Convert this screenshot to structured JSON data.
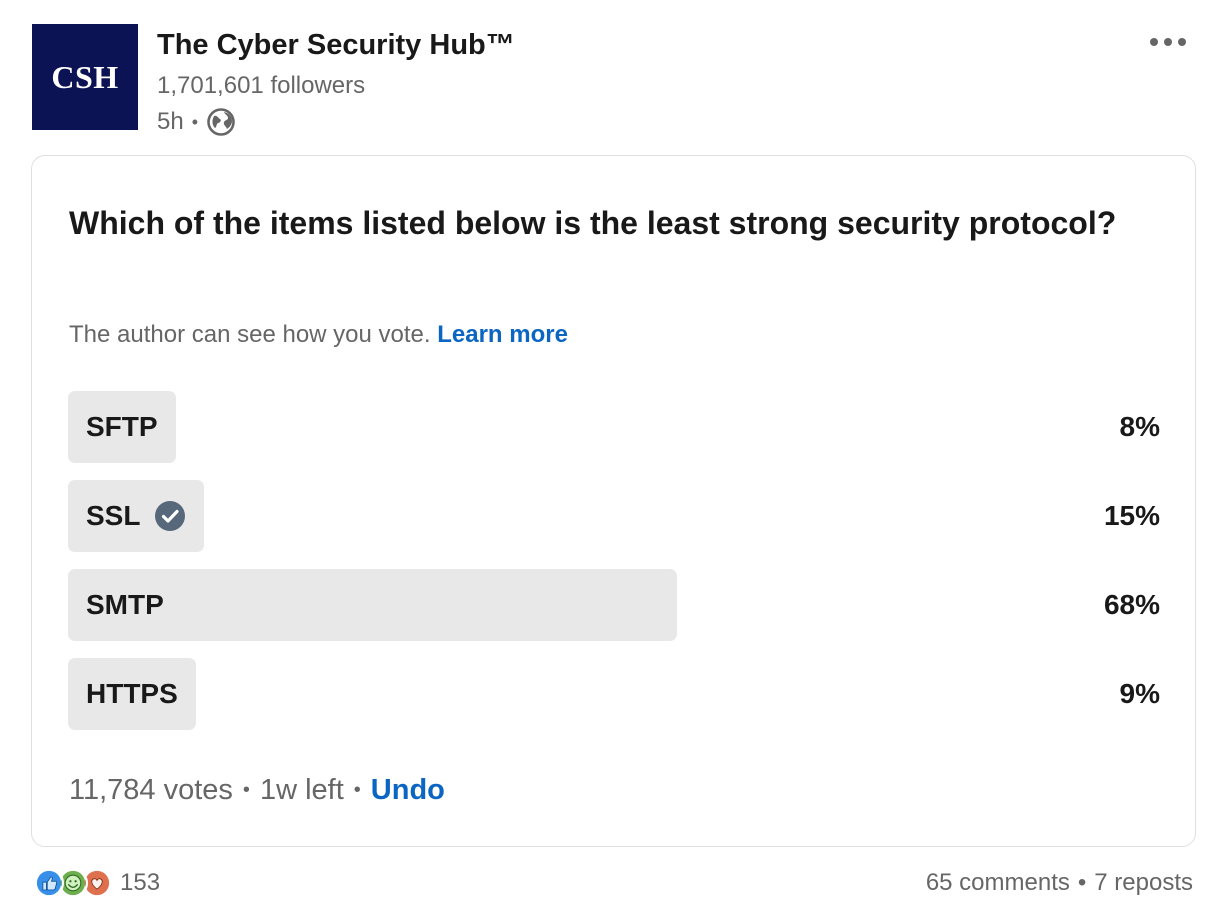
{
  "author": {
    "logo_text": "CSH",
    "name": "The Cyber Security Hub™",
    "followers": "1,701,601 followers",
    "time": "5h",
    "separator": "•"
  },
  "poll": {
    "question": "Which of the items listed below is the least strong security protocol?",
    "visibility_text": "The author can see how you vote.",
    "learn_more": "Learn more",
    "options": [
      {
        "label": "SFTP",
        "percent": "8%",
        "fraction": 0.08,
        "selected": false
      },
      {
        "label": "SSL",
        "percent": "15%",
        "fraction": 0.15,
        "selected": true
      },
      {
        "label": "SMTP",
        "percent": "68%",
        "fraction": 0.68,
        "selected": false
      },
      {
        "label": "HTTPS",
        "percent": "9%",
        "fraction": 0.09,
        "selected": false
      }
    ],
    "votes": "11,784 votes",
    "time_left": "1w left",
    "undo": "Undo",
    "separator": "•"
  },
  "social": {
    "reaction_count": "153",
    "reactions": [
      "like-icon",
      "celebrate-icon",
      "love-icon"
    ],
    "comments": "65 comments",
    "reposts": "7 reposts",
    "separator": "•"
  },
  "colors": {
    "logo_bg": "#0c1354",
    "link": "#0a66c2",
    "bar": "#e8e8e8",
    "check": "#56687a"
  }
}
